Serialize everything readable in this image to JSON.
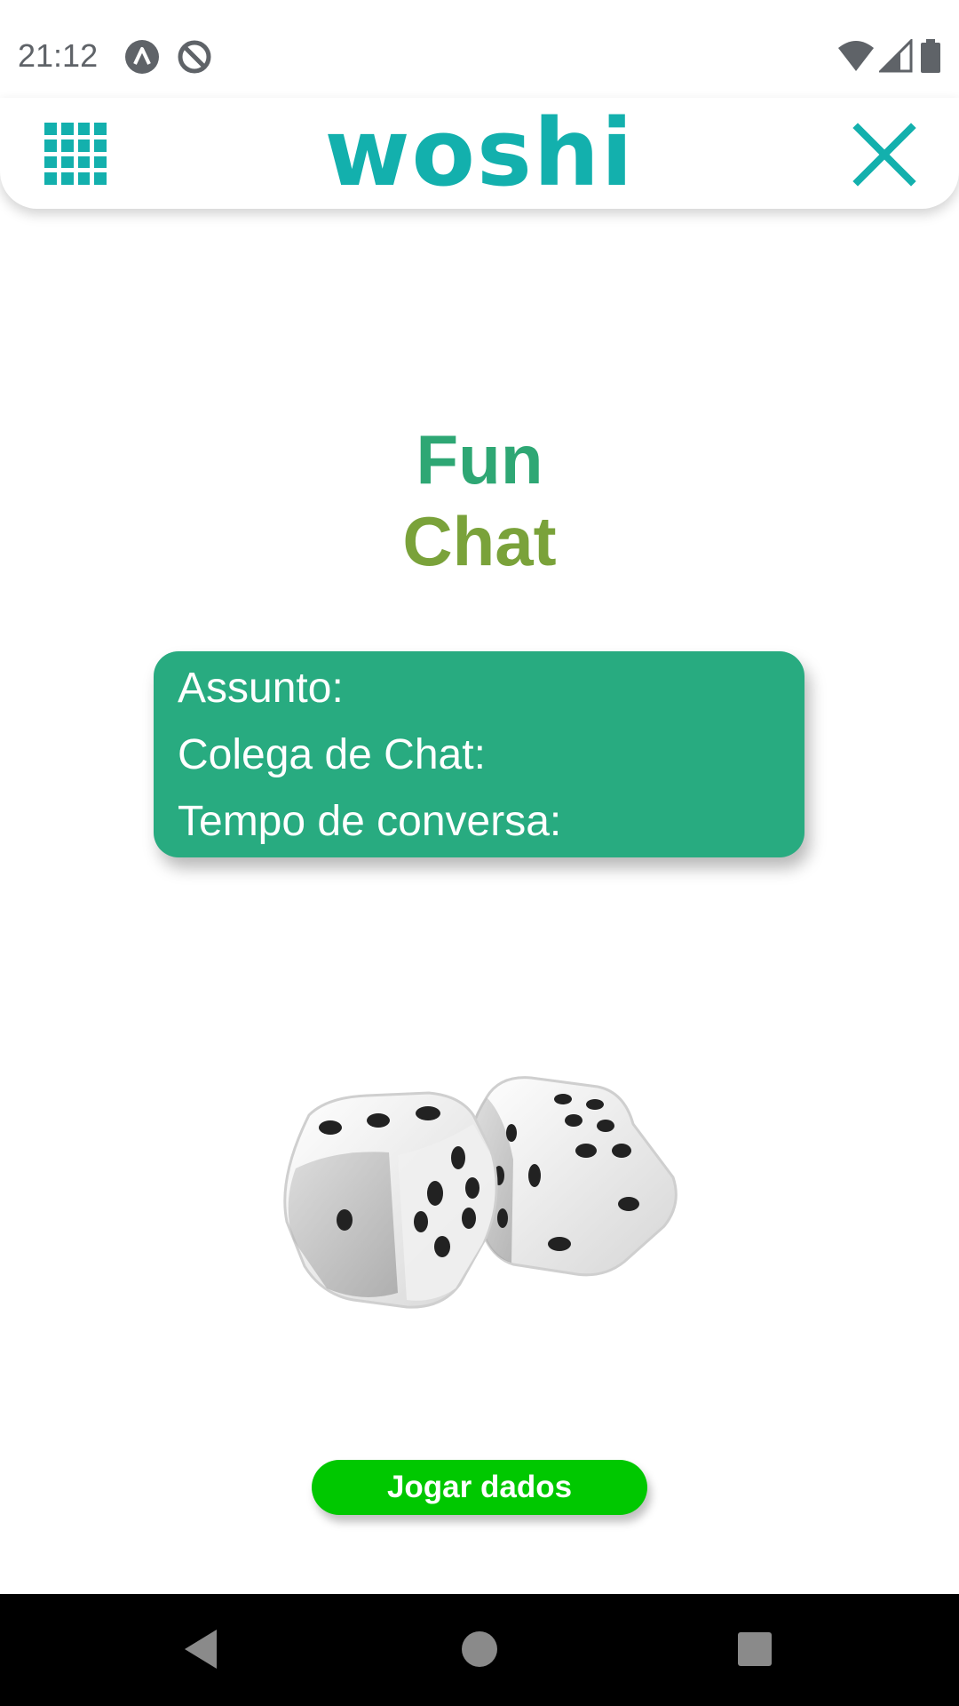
{
  "status_bar": {
    "time": "21:12",
    "left_icons": [
      "notification-a-icon",
      "notification-at-icon"
    ],
    "right_icons": [
      "wifi-icon",
      "cellular-signal-icon",
      "battery-icon"
    ]
  },
  "app_bar": {
    "logo": "woshi",
    "menu_icon": "grid-menu-icon",
    "close_icon": "close-icon",
    "accent_color": "#13b0ad"
  },
  "main": {
    "title_line1": "Fun",
    "title_line2": "Chat",
    "title_colors": [
      "#2ea774",
      "#7aa23a"
    ],
    "info_card": {
      "subject_label": "Assunto:",
      "partner_label": "Colega de Chat:",
      "duration_label": "Tempo de conversa:",
      "color": "#28ab80"
    },
    "dice_image": "dice-icon",
    "roll_button_label": "Jogar dados",
    "roll_button_color": "#00c800"
  },
  "nav_bar": {
    "icons": [
      "back-icon",
      "home-icon",
      "recents-icon"
    ]
  }
}
